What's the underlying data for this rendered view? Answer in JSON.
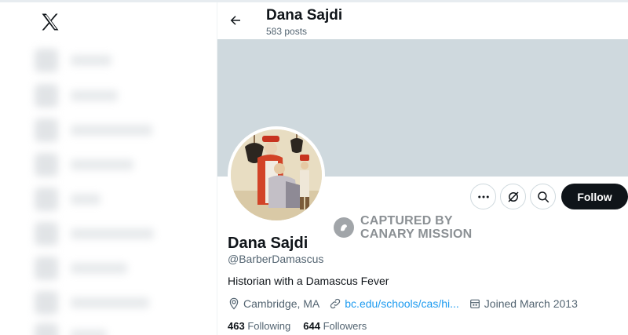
{
  "header": {
    "name": "Dana Sajdi",
    "posts": "583 posts"
  },
  "profile": {
    "name": "Dana Sajdi",
    "handle": "@BarberDamascus",
    "bio": "Historian with a Damascus Fever",
    "location": "Cambridge, MA",
    "website": "bc.edu/schools/cas/hi...",
    "joined": "Joined March 2013",
    "following_count": "463",
    "following_label": "Following",
    "followers_count": "644",
    "followers_label": "Followers"
  },
  "actions": {
    "follow_label": "Follow"
  },
  "watermark": {
    "line1": "CAPTURED BY",
    "line2": "CANARY MISSION"
  },
  "icons": {
    "logo": "x-logo-icon",
    "back": "arrow-left-icon",
    "more": "more-dots-icon",
    "grok": "grok-icon",
    "search": "search-icon",
    "location": "location-pin-icon",
    "link": "link-icon",
    "calendar": "calendar-icon"
  },
  "colors": {
    "banner": "#cfd9de",
    "link": "#1d9bf0",
    "follow_button": "#0f1419",
    "secondary_text": "#536471"
  }
}
